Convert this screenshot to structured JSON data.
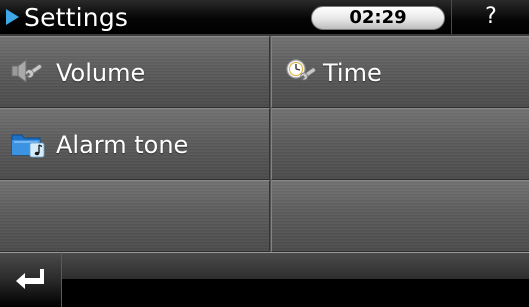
{
  "header": {
    "title": "Settings",
    "clock": "02:29",
    "help_label": "?"
  },
  "menu": {
    "items": [
      {
        "label": "Volume",
        "icon": "speaker-wrench-icon"
      },
      {
        "label": "Time",
        "icon": "clock-wrench-icon"
      },
      {
        "label": "Alarm tone",
        "icon": "music-folder-icon"
      }
    ]
  },
  "footer": {
    "back_icon": "return-arrow-icon"
  },
  "colors": {
    "accent": "#3fa9e8",
    "background": "#000000",
    "cell": "#5c5c5c",
    "text": "#ffffff"
  }
}
